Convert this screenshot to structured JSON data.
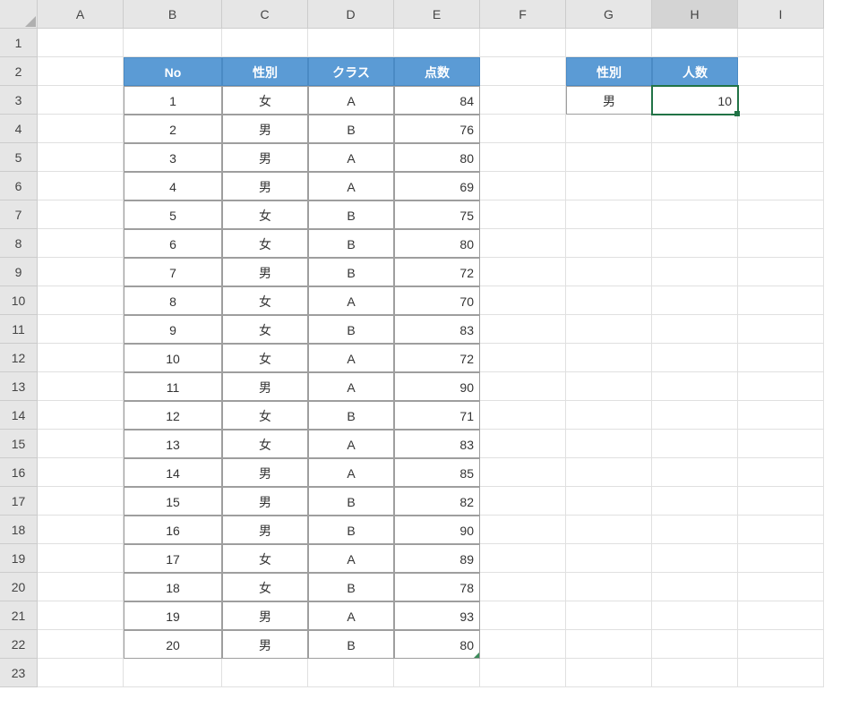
{
  "columns": [
    "A",
    "B",
    "C",
    "D",
    "E",
    "F",
    "G",
    "H",
    "I"
  ],
  "rowCount": 23,
  "selectedCell": "H3",
  "mainTable": {
    "headers": {
      "no": "No",
      "gender": "性別",
      "class": "クラス",
      "score": "点数"
    },
    "rows": [
      {
        "no": "1",
        "gender": "女",
        "class": "A",
        "score": "84"
      },
      {
        "no": "2",
        "gender": "男",
        "class": "B",
        "score": "76"
      },
      {
        "no": "3",
        "gender": "男",
        "class": "A",
        "score": "80"
      },
      {
        "no": "4",
        "gender": "男",
        "class": "A",
        "score": "69"
      },
      {
        "no": "5",
        "gender": "女",
        "class": "B",
        "score": "75"
      },
      {
        "no": "6",
        "gender": "女",
        "class": "B",
        "score": "80"
      },
      {
        "no": "7",
        "gender": "男",
        "class": "B",
        "score": "72"
      },
      {
        "no": "8",
        "gender": "女",
        "class": "A",
        "score": "70"
      },
      {
        "no": "9",
        "gender": "女",
        "class": "B",
        "score": "83"
      },
      {
        "no": "10",
        "gender": "女",
        "class": "A",
        "score": "72"
      },
      {
        "no": "11",
        "gender": "男",
        "class": "A",
        "score": "90"
      },
      {
        "no": "12",
        "gender": "女",
        "class": "B",
        "score": "71"
      },
      {
        "no": "13",
        "gender": "女",
        "class": "A",
        "score": "83"
      },
      {
        "no": "14",
        "gender": "男",
        "class": "A",
        "score": "85"
      },
      {
        "no": "15",
        "gender": "男",
        "class": "B",
        "score": "82"
      },
      {
        "no": "16",
        "gender": "男",
        "class": "B",
        "score": "90"
      },
      {
        "no": "17",
        "gender": "女",
        "class": "A",
        "score": "89"
      },
      {
        "no": "18",
        "gender": "女",
        "class": "B",
        "score": "78"
      },
      {
        "no": "19",
        "gender": "男",
        "class": "A",
        "score": "93"
      },
      {
        "no": "20",
        "gender": "男",
        "class": "B",
        "score": "80"
      }
    ]
  },
  "summaryTable": {
    "headers": {
      "gender": "性別",
      "count": "人数"
    },
    "row": {
      "gender": "男",
      "count": "10"
    }
  }
}
